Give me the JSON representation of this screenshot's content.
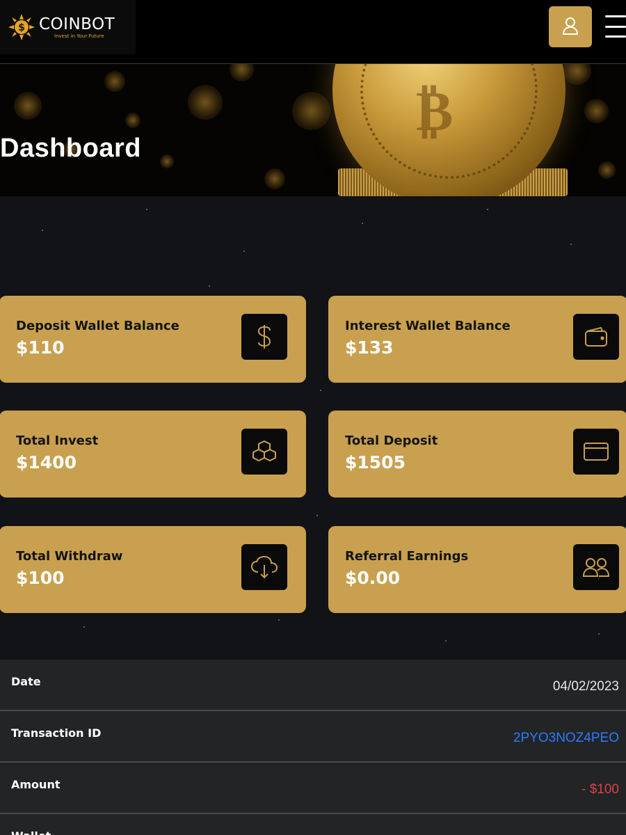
{
  "header": {
    "logo_name": "COINBOT",
    "logo_tagline": "Invest in Your Future",
    "accent_color": "#c9a04f",
    "user_icon": "user-icon",
    "menu_icon": "hamburger-icon"
  },
  "hero": {
    "title": "Dashboard"
  },
  "cards": [
    {
      "label": "Deposit Wallet Balance",
      "value": "$110",
      "icon": "dollar-icon"
    },
    {
      "label": "Interest Wallet Balance",
      "value": "$133",
      "icon": "wallet-icon"
    },
    {
      "label": "Total Invest",
      "value": "$1400",
      "icon": "cubes-icon"
    },
    {
      "label": "Total Deposit",
      "value": "$1505",
      "icon": "credit-card-icon"
    },
    {
      "label": "Total Withdraw",
      "value": "$100",
      "icon": "cloud-download-icon"
    },
    {
      "label": "Referral Earnings",
      "value": "$0.00",
      "icon": "users-icon"
    }
  ],
  "transaction": {
    "rows": [
      {
        "key": "Date",
        "value": "04/02/2023"
      },
      {
        "key": "Transaction ID",
        "value": "2PYO3NOZ4PEO"
      },
      {
        "key": "Amount",
        "value": "- $100"
      },
      {
        "key": "Wallet",
        "value": ""
      }
    ],
    "id_color": "#2a7bff",
    "amount_color": "#e0404a"
  }
}
